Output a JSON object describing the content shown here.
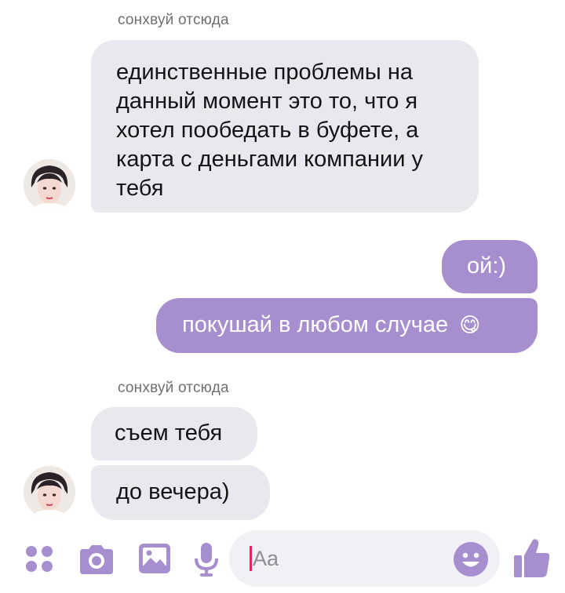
{
  "colors": {
    "accent": "#a78fcf",
    "incoming_bubble": "#e9e8ee",
    "icon": "#a78fcf"
  },
  "messages": [
    {
      "sender": "сонхвуй отсюда",
      "direction": "incoming",
      "text": "единственные проблемы на данный момент это то, что я хотел пообедать в буфете, а карта с деньгами компании у тебя"
    },
    {
      "direction": "outgoing",
      "text": "ой:)"
    },
    {
      "direction": "outgoing",
      "text": "покушай в любом случае",
      "emoji": "😋"
    },
    {
      "sender": "сонхвуй отсюда",
      "direction": "incoming",
      "text": "съем тебя"
    },
    {
      "direction": "incoming",
      "text": "до вечера)"
    }
  ],
  "composer": {
    "placeholder": "Aa",
    "icons": [
      "apps-icon",
      "camera-icon",
      "gallery-icon",
      "microphone-icon",
      "emoji-icon",
      "thumbs-up-icon"
    ]
  }
}
